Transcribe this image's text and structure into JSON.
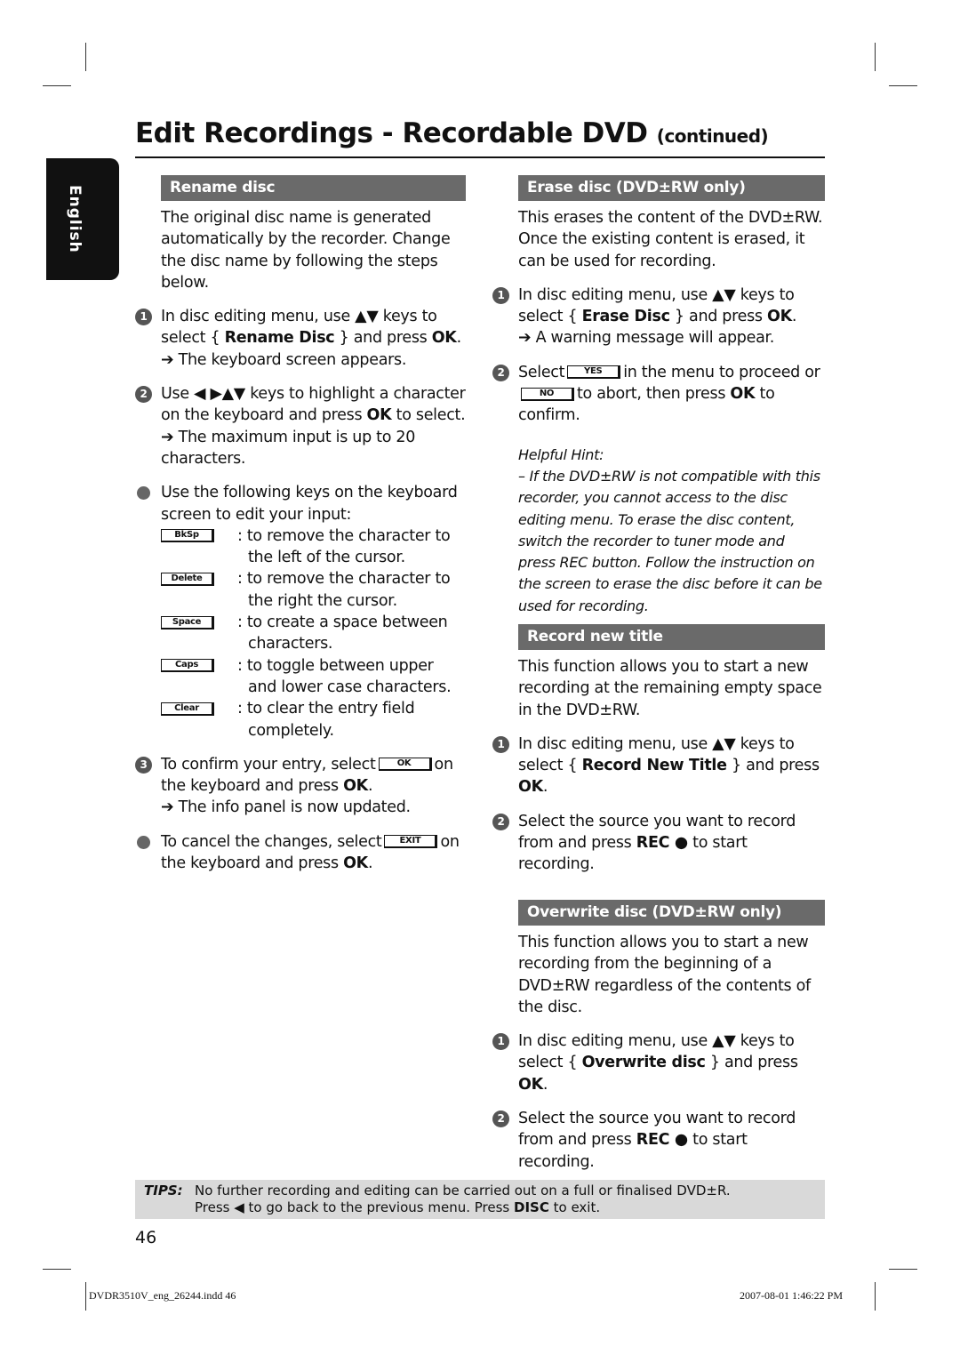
{
  "title": {
    "main": "Edit Recordings - Recordable DVD",
    "suffix": "(continued)"
  },
  "side_tab": "English",
  "left": {
    "header": "Rename disc",
    "blocks": [
      {
        "type": "para",
        "segs": [
          {
            "t": "The original disc name is generated automatically by the recorder. Change the disc name by following the steps below."
          }
        ]
      },
      {
        "type": "step",
        "n": "1",
        "segs": [
          {
            "t": "In disc editing menu, use ▲▼ keys to select { "
          },
          {
            "b": "Rename Disc"
          },
          {
            "t": " } and press "
          },
          {
            "b": "OK"
          },
          {
            "t": "."
          },
          {
            "br": 1
          },
          {
            "t": "➔ The keyboard screen appears."
          }
        ]
      },
      {
        "type": "step",
        "n": "2",
        "segs": [
          {
            "t": "Use ◀ ▶▲▼ keys to highlight a character on the keyboard and press "
          },
          {
            "b": "OK"
          },
          {
            "t": " to select."
          },
          {
            "br": 1
          },
          {
            "t": "➔ The maximum input is up to 20 characters."
          }
        ]
      },
      {
        "type": "bullet",
        "segs": [
          {
            "t": "Use the following keys on the keyboard screen to edit your input:"
          }
        ],
        "keys": [
          {
            "key": "BkSp",
            "desc": ": to remove the character to the left of the cursor."
          },
          {
            "key": "Delete",
            "desc": ": to remove the character to the right the cursor."
          },
          {
            "key": "Space",
            "desc": ": to create a space between characters."
          },
          {
            "key": "Caps",
            "desc": ": to toggle between upper and lower case characters."
          },
          {
            "key": "Clear",
            "desc": ": to clear the entry field completely."
          }
        ]
      },
      {
        "type": "step",
        "n": "3",
        "segs": [
          {
            "t": "To confirm your entry, select"
          },
          {
            "key": "OK"
          },
          {
            "t": "on the keyboard and press "
          },
          {
            "b": "OK"
          },
          {
            "t": "."
          },
          {
            "br": 1
          },
          {
            "t": "➔ The info panel is now updated."
          }
        ]
      },
      {
        "type": "bullet",
        "segs": [
          {
            "t": "To cancel the changes, select"
          },
          {
            "key": "EXIT"
          },
          {
            "t": "on the keyboard and press "
          },
          {
            "b": "OK"
          },
          {
            "t": "."
          }
        ]
      }
    ]
  },
  "right": [
    {
      "header": "Erase disc (DVD±RW only)",
      "blocks": [
        {
          "type": "para",
          "segs": [
            {
              "t": "This erases the content of the DVD±RW. Once the existing content is erased, it can be used for recording."
            }
          ]
        },
        {
          "type": "step",
          "n": "1",
          "segs": [
            {
              "t": "In disc editing menu, use ▲▼ keys to select { "
            },
            {
              "b": "Erase Disc"
            },
            {
              "t": " } and press "
            },
            {
              "b": "OK"
            },
            {
              "t": "."
            },
            {
              "br": 1
            },
            {
              "t": "➔ A warning message will appear."
            }
          ]
        },
        {
          "type": "step",
          "n": "2",
          "segs": [
            {
              "t": "Select"
            },
            {
              "key": "YES"
            },
            {
              "t": "in the menu to proceed or"
            },
            {
              "br": 1
            },
            {
              "key": "NO"
            },
            {
              "t": "to abort, then press "
            },
            {
              "b": "OK"
            },
            {
              "t": " to confirm."
            }
          ]
        },
        {
          "type": "hint",
          "segs": [
            {
              "t": "Helpful Hint:"
            },
            {
              "br": 1
            },
            {
              "t": "–  If the DVD±RW is not compatible with this recorder, you cannot access to the disc editing menu.  To erase the disc content, switch the recorder to tuner mode and press REC button. Follow the instruction on the screen to erase the disc before it can be used for recording."
            }
          ]
        }
      ]
    },
    {
      "header": "Record new title",
      "blocks": [
        {
          "type": "para",
          "segs": [
            {
              "t": "This function allows you to start a new recording at the remaining empty space in the DVD±RW."
            }
          ]
        },
        {
          "type": "step",
          "n": "1",
          "segs": [
            {
              "t": "In disc editing menu, use ▲▼ keys to select { "
            },
            {
              "b": "Record New Title"
            },
            {
              "t": " } and press "
            },
            {
              "b": "OK"
            },
            {
              "t": "."
            }
          ]
        },
        {
          "type": "step",
          "n": "2",
          "segs": [
            {
              "t": "Select the source you want to record from and press "
            },
            {
              "b": "REC ●"
            },
            {
              "t": " to start recording."
            }
          ]
        }
      ]
    },
    {
      "header": "Overwrite disc (DVD±RW only)",
      "blocks": [
        {
          "type": "para",
          "segs": [
            {
              "t": "This function allows you to start a new recording from the beginning of a DVD±RW regardless of the contents of the disc."
            }
          ]
        },
        {
          "type": "step",
          "n": "1",
          "segs": [
            {
              "t": "In disc editing menu, use ▲▼ keys to select { "
            },
            {
              "b": "Overwrite disc"
            },
            {
              "t": " } and press "
            },
            {
              "b": "OK"
            },
            {
              "t": "."
            }
          ]
        },
        {
          "type": "step",
          "n": "2",
          "segs": [
            {
              "t": "Select the source you want to record from and press "
            },
            {
              "b": "REC ●"
            },
            {
              "t": " to start recording."
            }
          ]
        }
      ]
    }
  ],
  "tips": {
    "label": "TIPS:",
    "line1": "No further recording and editing can be carried out on a full or finalised DVD±R.",
    "line2_a": "Press ◀ to go back to the previous menu. Press ",
    "line2_b": "DISC",
    "line2_c": " to exit."
  },
  "page_number": "46",
  "footer": {
    "file": "DVDR3510V_eng_26244.indd   46",
    "date": "2007-08-01   1:46:22 PM"
  }
}
